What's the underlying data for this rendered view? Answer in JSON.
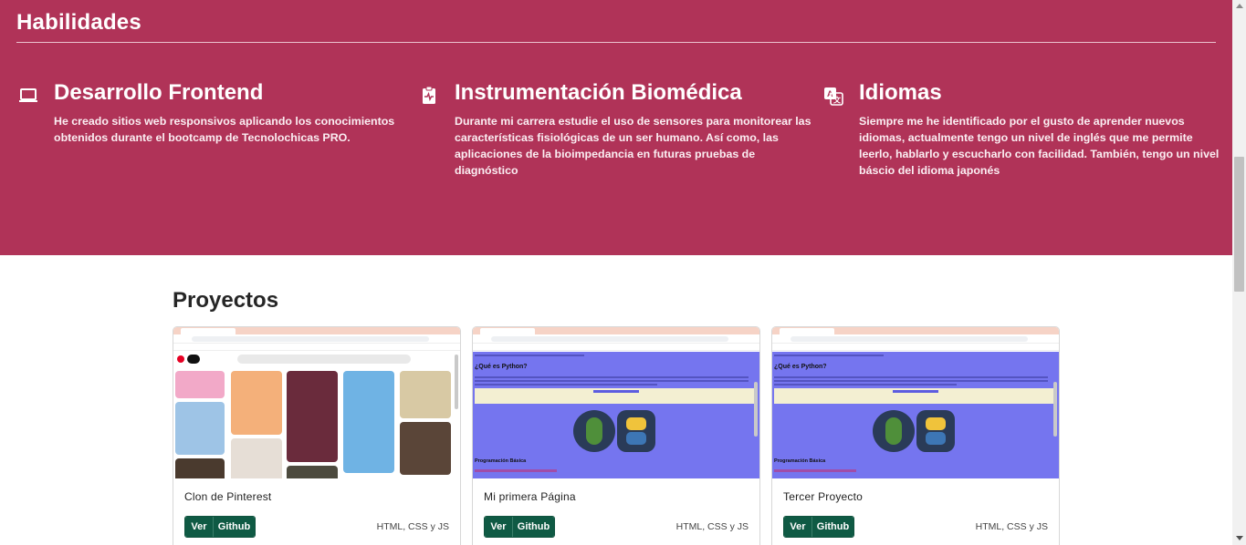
{
  "skills": {
    "title": "Habilidades",
    "items": [
      {
        "icon": "laptop-icon",
        "heading": "Desarrollo Frontend",
        "description": "He creado sitios web responsivos aplicando los conocimientos obtenidos durante el bootcamp de Tecnolochicas PRO."
      },
      {
        "icon": "clipboard-pulse-icon",
        "heading": "Instrumentación Biomédica",
        "description": "Durante mi carrera estudie el uso de sensores para monitorear las características fisiológicas de un ser humano. Así como, las aplicaciones de la bioimpedancia en futuras pruebas de diagnóstico"
      },
      {
        "icon": "translate-icon",
        "heading": "Idiomas",
        "description": "Siempre me he identificado por el gusto de aprender nuevos idiomas, actualmente tengo un nivel de inglés que me permite leerlo, hablarlo y escucharlo con facilidad. También, tengo un nivel báscio del idioma japonés"
      }
    ]
  },
  "projects": {
    "title": "Proyectos",
    "cards": [
      {
        "title": "Clon de Pinterest",
        "view_label": "Ver",
        "github_label": "Github",
        "tech": "HTML, CSS y JS",
        "thumb": "pinterest-screenshot"
      },
      {
        "title": "Mi primera Página",
        "view_label": "Ver",
        "github_label": "Github",
        "tech": "HTML, CSS y JS",
        "thumb": "python-page-screenshot",
        "thumb_heading": "¿Qué es Python?",
        "thumb_subheading": "Programación Básica"
      },
      {
        "title": "Tercer Proyecto",
        "view_label": "Ver",
        "github_label": "Github",
        "tech": "HTML, CSS y JS",
        "thumb": "python-page-screenshot",
        "thumb_heading": "¿Qué es Python?",
        "thumb_subheading": "Programación Básica"
      }
    ]
  },
  "colors": {
    "skills_bg": "#b03358",
    "button_bg": "#0f5a44",
    "thumb_page_bg": "#7575ef"
  }
}
